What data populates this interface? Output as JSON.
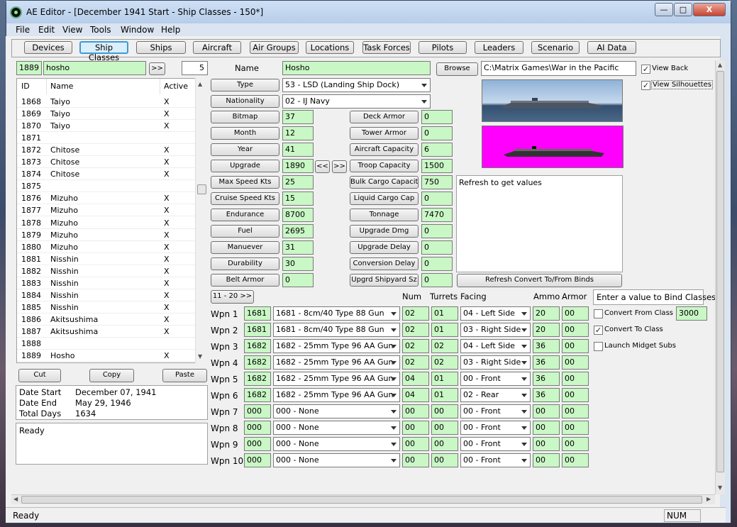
{
  "window": {
    "title": "AE Editor - [December 1941 Start - Ship Classes - 150*]",
    "min": "—",
    "max": "□",
    "close": "X"
  },
  "menu": [
    "File",
    "Edit",
    "View",
    "Tools",
    "Window",
    "Help"
  ],
  "tabs": [
    "Devices",
    "Ship Classes",
    "Ships",
    "Aircraft",
    "Air Groups",
    "Locations",
    "Task Forces",
    "Pilots",
    "Leaders",
    "Scenario",
    "AI Data"
  ],
  "selected_tab": "Ship Classes",
  "search": {
    "id": "1889",
    "name": "hosho",
    "go": ">>",
    "count": "5"
  },
  "list": {
    "headers": [
      "ID",
      "Name",
      "Active"
    ],
    "rows": [
      [
        "1868",
        "Taiyo",
        "X"
      ],
      [
        "1869",
        "Taiyo",
        "X"
      ],
      [
        "1870",
        "Taiyo",
        "X"
      ],
      [
        "1871",
        "",
        ""
      ],
      [
        "1872",
        "Chitose",
        "X"
      ],
      [
        "1873",
        "Chitose",
        "X"
      ],
      [
        "1874",
        "Chitose",
        "X"
      ],
      [
        "1875",
        "",
        ""
      ],
      [
        "1876",
        "Mizuho",
        "X"
      ],
      [
        "1877",
        "Mizuho",
        "X"
      ],
      [
        "1878",
        "Mizuho",
        "X"
      ],
      [
        "1879",
        "Mizuho",
        "X"
      ],
      [
        "1880",
        "Mizuho",
        "X"
      ],
      [
        "1881",
        "Nisshin",
        "X"
      ],
      [
        "1882",
        "Nisshin",
        "X"
      ],
      [
        "1883",
        "Nisshin",
        "X"
      ],
      [
        "1884",
        "Nisshin",
        "X"
      ],
      [
        "1885",
        "Nisshin",
        "X"
      ],
      [
        "1886",
        "Akitsushima",
        "X"
      ],
      [
        "1887",
        "Akitsushima",
        "X"
      ],
      [
        "1888",
        "",
        ""
      ],
      [
        "1889",
        "Hosho",
        "X"
      ]
    ]
  },
  "clip": {
    "cut": "Cut",
    "copy": "Copy",
    "paste": "Paste"
  },
  "dates": {
    "start_label": "Date Start",
    "start": "December 07, 1941",
    "end_label": "Date End",
    "end": "May 29, 1946",
    "days_label": "Total Days",
    "days": "1634"
  },
  "log": "Ready",
  "form": {
    "name_label": "Name",
    "name": "Hosho",
    "browse": "Browse",
    "path": "C:\\Matrix Games\\War in the Pacific",
    "type_label": "Type",
    "type": "53 - LSD (Landing Ship Dock)",
    "nation_label": "Nationality",
    "nation": "02 - IJ Navy",
    "left": [
      [
        "Bitmap",
        "37"
      ],
      [
        "Month",
        "12"
      ],
      [
        "Year",
        "41"
      ],
      [
        "Upgrade",
        "1890"
      ],
      [
        "Max Speed Kts",
        "25"
      ],
      [
        "Cruise Speed Kts",
        "15"
      ],
      [
        "Endurance",
        "8700"
      ],
      [
        "Fuel",
        "2695"
      ],
      [
        "Manuever",
        "31"
      ],
      [
        "Durability",
        "30"
      ],
      [
        "Belt Armor",
        "0"
      ]
    ],
    "right": [
      [
        "Deck Armor",
        "0"
      ],
      [
        "Tower Armor",
        "0"
      ],
      [
        "Aircraft Capacity",
        "6"
      ],
      [
        "Troop Capacity",
        "1500"
      ],
      [
        "Bulk Cargo Capacity",
        "750"
      ],
      [
        "Liquid Cargo Cap",
        "0"
      ],
      [
        "Tonnage",
        "7470"
      ],
      [
        "Upgrade Dmg",
        "0"
      ],
      [
        "Upgrade Delay",
        "0"
      ],
      [
        "Conversion Delay",
        "0"
      ],
      [
        "Upgrd Shipyard Sz",
        "0"
      ]
    ],
    "prev": "<<",
    "next": ">>",
    "view_back": "View Back",
    "view_sil": "View Silhouettes",
    "refresh_text": "Refresh to get values",
    "refresh_btn": "Refresh Convert To/From Binds",
    "page_btn": "11 - 20 >>"
  },
  "weapons": {
    "headers": [
      "Num",
      "Turrets",
      "Facing",
      "Ammo",
      "Armor"
    ],
    "rows": [
      [
        "Wpn 1",
        "1681",
        "1681 - 8cm/40 Type 88 Gun",
        "02",
        "01",
        "04 - Left Side",
        "20",
        "00"
      ],
      [
        "Wpn 2",
        "1681",
        "1681 - 8cm/40 Type 88 Gun",
        "02",
        "01",
        "03 - Right Side",
        "20",
        "00"
      ],
      [
        "Wpn 3",
        "1682",
        "1682 - 25mm Type 96 AA Gun",
        "02",
        "02",
        "04 - Left Side",
        "36",
        "00"
      ],
      [
        "Wpn 4",
        "1682",
        "1682 - 25mm Type 96 AA Gun",
        "02",
        "02",
        "03 - Right Side",
        "36",
        "00"
      ],
      [
        "Wpn 5",
        "1682",
        "1682 - 25mm Type 96 AA Gun",
        "04",
        "01",
        "00 - Front",
        "36",
        "00"
      ],
      [
        "Wpn 6",
        "1682",
        "1682 - 25mm Type 96 AA Gun",
        "04",
        "01",
        "02 - Rear",
        "36",
        "00"
      ],
      [
        "Wpn 7",
        "000",
        "000 - None",
        "00",
        "00",
        "00 - Front",
        "00",
        "00"
      ],
      [
        "Wpn 8",
        "000",
        "000 - None",
        "00",
        "00",
        "00 - Front",
        "00",
        "00"
      ],
      [
        "Wpn 9",
        "000",
        "000 - None",
        "00",
        "00",
        "00 - Front",
        "00",
        "00"
      ],
      [
        "Wpn 10",
        "000",
        "000 - None",
        "00",
        "00",
        "00 - Front",
        "00",
        "00"
      ]
    ]
  },
  "bind": {
    "label": "Enter a value to Bind Classes",
    "from": "Convert From Class",
    "from_val": "3000",
    "to": "Convert To Class",
    "midget": "Launch Midget Subs"
  },
  "status": {
    "text": "Ready",
    "num": "NUM"
  }
}
